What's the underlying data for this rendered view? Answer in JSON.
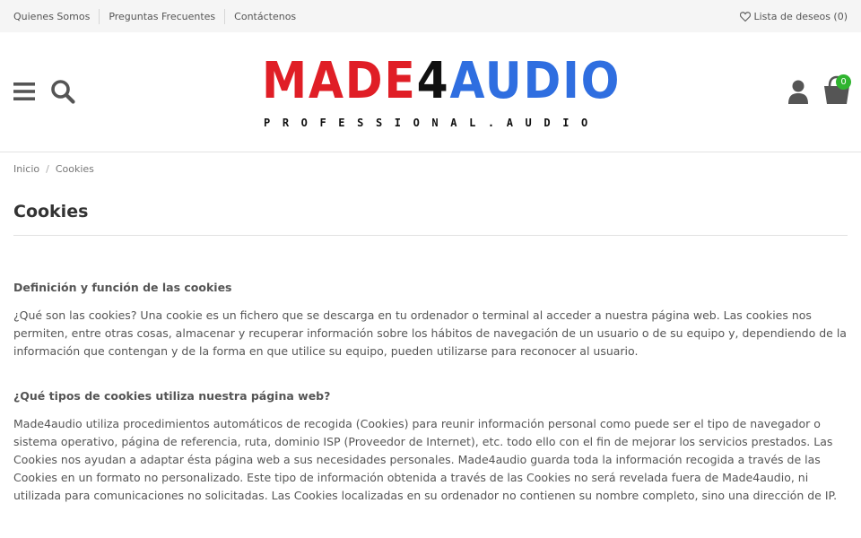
{
  "topbar": {
    "links": [
      "Quienes Somos",
      "Preguntas Frecuentes",
      "Contáctenos"
    ],
    "wishlist_label": "Lista de deseos (0)"
  },
  "header": {
    "logo_parts": {
      "made": "MADE",
      "four": "4",
      "audio": "AUDIO"
    },
    "logo_subtitle": "PROFESSIONAL.AUDIO",
    "cart_count": "0",
    "icons": [
      "menu-icon",
      "search-icon",
      "user-icon",
      "cart-icon",
      "heart-icon"
    ],
    "colors": {
      "logo_red": "#e01e26",
      "logo_blue": "#2f6ee0",
      "badge_green": "#2fb42f"
    }
  },
  "breadcrumb": {
    "home": "Inicio",
    "separator": "/",
    "current": "Cookies"
  },
  "page": {
    "title": "Cookies",
    "sections": [
      {
        "heading": "Definición y función de las cookies",
        "body": "¿Qué son las cookies? Una cookie es un fichero que se descarga en tu ordenador o terminal al acceder a nuestra página web. Las cookies nos permiten, entre otras cosas, almacenar y recuperar información sobre los hábitos de navegación de un usuario o de su equipo y, dependiendo de la información que contengan y de la forma en que utilice su equipo, pueden utilizarse para reconocer al usuario."
      },
      {
        "heading": "¿Qué tipos de cookies utiliza nuestra página web?",
        "body": "Made4audio utiliza procedimientos automáticos de recogida (Cookies) para reunir información personal como puede ser el tipo de navegador o sistema operativo, página de referencia, ruta, dominio ISP (Proveedor de Internet), etc. todo ello con el fin de mejorar los servicios prestados. Las Cookies nos ayudan a adaptar ésta página web a sus necesidades personales.  Made4audio guarda toda la información recogida a través de las Cookies en un formato no personalizado. Este tipo de información obtenida a través de las Cookies no será revelada fuera de Made4audio, ni utilizada para comunicaciones no solicitadas.  Las Cookies localizadas en su ordenador no contienen su nombre completo, sino una dirección de IP."
      }
    ]
  }
}
